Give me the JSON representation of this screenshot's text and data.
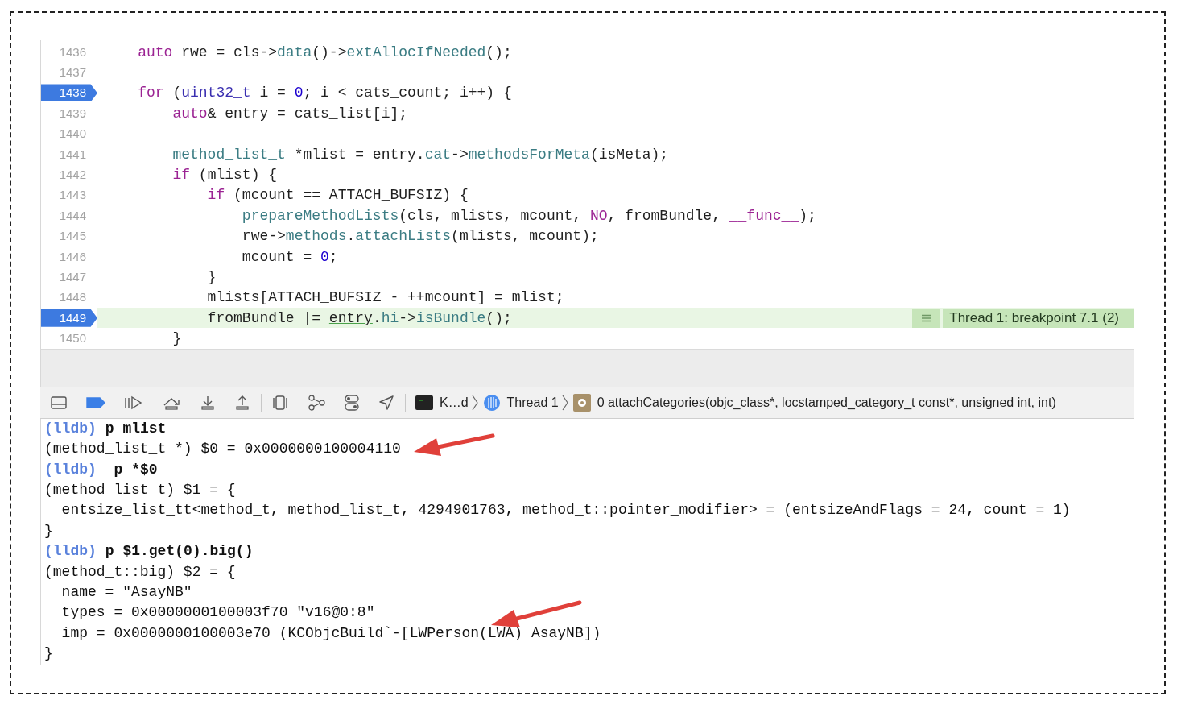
{
  "editor": {
    "lines": [
      {
        "number": "1436",
        "breakpoint": false,
        "current": false,
        "tokens": [
          {
            "text": "    auto",
            "kind": "keyword"
          },
          {
            "text": " rwe = cls->",
            "kind": "plain"
          },
          {
            "text": "data",
            "kind": "func"
          },
          {
            "text": "()->",
            "kind": "plain"
          },
          {
            "text": "extAllocIfNeeded",
            "kind": "func"
          },
          {
            "text": "();",
            "kind": "plain"
          }
        ]
      },
      {
        "number": "1437",
        "breakpoint": false,
        "current": false
      },
      {
        "number": "1438",
        "breakpoint": true,
        "current": false,
        "tokens": [
          {
            "text": "    for",
            "kind": "keyword"
          },
          {
            "text": " (",
            "kind": "plain"
          },
          {
            "text": "uint32_t",
            "kind": "type"
          },
          {
            "text": " i = ",
            "kind": "plain"
          },
          {
            "text": "0",
            "kind": "number"
          },
          {
            "text": "; i < cats_count; i++) {",
            "kind": "plain"
          }
        ]
      },
      {
        "number": "1439",
        "breakpoint": false,
        "current": false,
        "tokens": [
          {
            "text": "        auto",
            "kind": "keyword"
          },
          {
            "text": "& entry = cats_list[i];",
            "kind": "plain"
          }
        ]
      },
      {
        "number": "1440",
        "breakpoint": false,
        "current": false
      },
      {
        "number": "1441",
        "breakpoint": false,
        "current": false,
        "tokens": [
          {
            "text": "        method_list_t",
            "kind": "func"
          },
          {
            "text": " *mlist = entry.",
            "kind": "plain"
          },
          {
            "text": "cat",
            "kind": "func"
          },
          {
            "text": "->",
            "kind": "plain"
          },
          {
            "text": "methodsForMeta",
            "kind": "func"
          },
          {
            "text": "(isMeta);",
            "kind": "plain"
          }
        ]
      },
      {
        "number": "1442",
        "breakpoint": false,
        "current": false,
        "tokens": [
          {
            "text": "        if",
            "kind": "keyword"
          },
          {
            "text": " (mlist) {",
            "kind": "plain"
          }
        ]
      },
      {
        "number": "1443",
        "breakpoint": false,
        "current": false,
        "tokens": [
          {
            "text": "            if",
            "kind": "keyword"
          },
          {
            "text": " (mcount == ATTACH_BUFSIZ) {",
            "kind": "plain"
          }
        ]
      },
      {
        "number": "1444",
        "breakpoint": false,
        "current": false,
        "tokens": [
          {
            "text": "                prepareMethodLists",
            "kind": "func"
          },
          {
            "text": "(cls, mlists, mcount, ",
            "kind": "plain"
          },
          {
            "text": "NO",
            "kind": "keyword"
          },
          {
            "text": ", fromBundle, ",
            "kind": "plain"
          },
          {
            "text": "__func__",
            "kind": "keyword"
          },
          {
            "text": ");",
            "kind": "plain"
          }
        ]
      },
      {
        "number": "1445",
        "breakpoint": false,
        "current": false,
        "tokens": [
          {
            "text": "                rwe->",
            "kind": "plain"
          },
          {
            "text": "methods",
            "kind": "func"
          },
          {
            "text": ".",
            "kind": "plain"
          },
          {
            "text": "attachLists",
            "kind": "func"
          },
          {
            "text": "(mlists, mcount);",
            "kind": "plain"
          }
        ]
      },
      {
        "number": "1446",
        "breakpoint": false,
        "current": false,
        "tokens": [
          {
            "text": "                mcount = ",
            "kind": "plain"
          },
          {
            "text": "0",
            "kind": "number"
          },
          {
            "text": ";",
            "kind": "plain"
          }
        ]
      },
      {
        "number": "1447",
        "breakpoint": false,
        "current": false,
        "tokens": [
          {
            "text": "            }",
            "kind": "plain"
          }
        ]
      },
      {
        "number": "1448",
        "breakpoint": false,
        "current": false,
        "tokens": [
          {
            "text": "            mlists[ATTACH_BUFSIZ - ++mcount] = mlist;",
            "kind": "plain"
          }
        ]
      },
      {
        "number": "1449",
        "breakpoint": true,
        "current": true,
        "annotation": "Thread 1: breakpoint 7.1 (2)",
        "tokens": [
          {
            "text": "            fromBundle |= ",
            "kind": "plain"
          },
          {
            "text": "entry",
            "kind": "underlined"
          },
          {
            "text": ".",
            "kind": "plain"
          },
          {
            "text": "hi",
            "kind": "func"
          },
          {
            "text": "->",
            "kind": "plain"
          },
          {
            "text": "isBundle",
            "kind": "func"
          },
          {
            "text": "();",
            "kind": "plain"
          }
        ]
      },
      {
        "number": "1450",
        "breakpoint": false,
        "current": false,
        "tokens": [
          {
            "text": "        }",
            "kind": "plain"
          }
        ]
      }
    ]
  },
  "debug_bar": {
    "breakpoints_active": true,
    "breadcrumbs": [
      {
        "kind": "app",
        "label": "K…d"
      },
      {
        "kind": "thread",
        "label": "Thread 1"
      },
      {
        "kind": "frame",
        "label": "0 attachCategories(objc_class*, locstamped_category_t const*, unsigned int, int)"
      }
    ]
  },
  "console": {
    "lines": [
      {
        "kind": "prompt",
        "prompt": "(lldb)",
        "command": "p mlist"
      },
      {
        "kind": "output",
        "text": "(method_list_t *) $0 = 0x0000000100004110"
      },
      {
        "kind": "prompt",
        "prompt": "(lldb)",
        "command": " p *$0"
      },
      {
        "kind": "output",
        "text": "(method_list_t) $1 = {"
      },
      {
        "kind": "output",
        "text": "  entsize_list_tt<method_t, method_list_t, 4294901763, method_t::pointer_modifier> = (entsizeAndFlags = 24, count = 1)"
      },
      {
        "kind": "output",
        "text": "}"
      },
      {
        "kind": "prompt",
        "prompt": "(lldb)",
        "command": "p $1.get(0).big()"
      },
      {
        "kind": "output",
        "text": "(method_t::big) $2 = {"
      },
      {
        "kind": "output",
        "text": "  name = \"AsayNB\""
      },
      {
        "kind": "output",
        "text": "  types = 0x0000000100003f70 \"v16@0:8\""
      },
      {
        "kind": "output",
        "text": "  imp = 0x0000000100003e70 (KCObjcBuild`-[LWPerson(LWA) AsayNB])"
      },
      {
        "kind": "output",
        "text": "}"
      }
    ]
  }
}
